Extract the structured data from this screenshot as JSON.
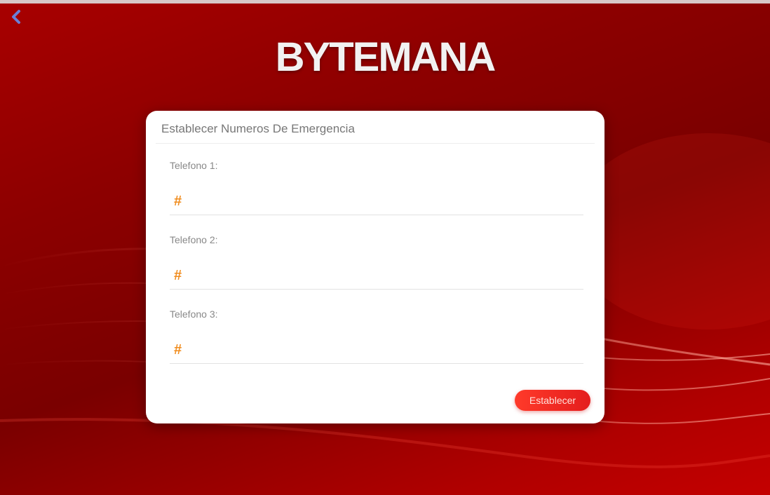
{
  "app": {
    "logo_text": "BYTEMANA",
    "colors": {
      "background": "#8c0000",
      "accent": "#f08c1e",
      "button": "#ff3a2a"
    }
  },
  "nav": {
    "back_icon": "chevron-left-icon"
  },
  "form": {
    "title": "Establecer Numeros De Emergencia",
    "fields": [
      {
        "label": "Telefono 1:",
        "prefix": "#",
        "value": "",
        "placeholder": ""
      },
      {
        "label": "Telefono 2:",
        "prefix": "#",
        "value": "",
        "placeholder": ""
      },
      {
        "label": "Telefono 3:",
        "prefix": "#",
        "value": "",
        "placeholder": ""
      }
    ],
    "submit_label": "Establecer"
  }
}
